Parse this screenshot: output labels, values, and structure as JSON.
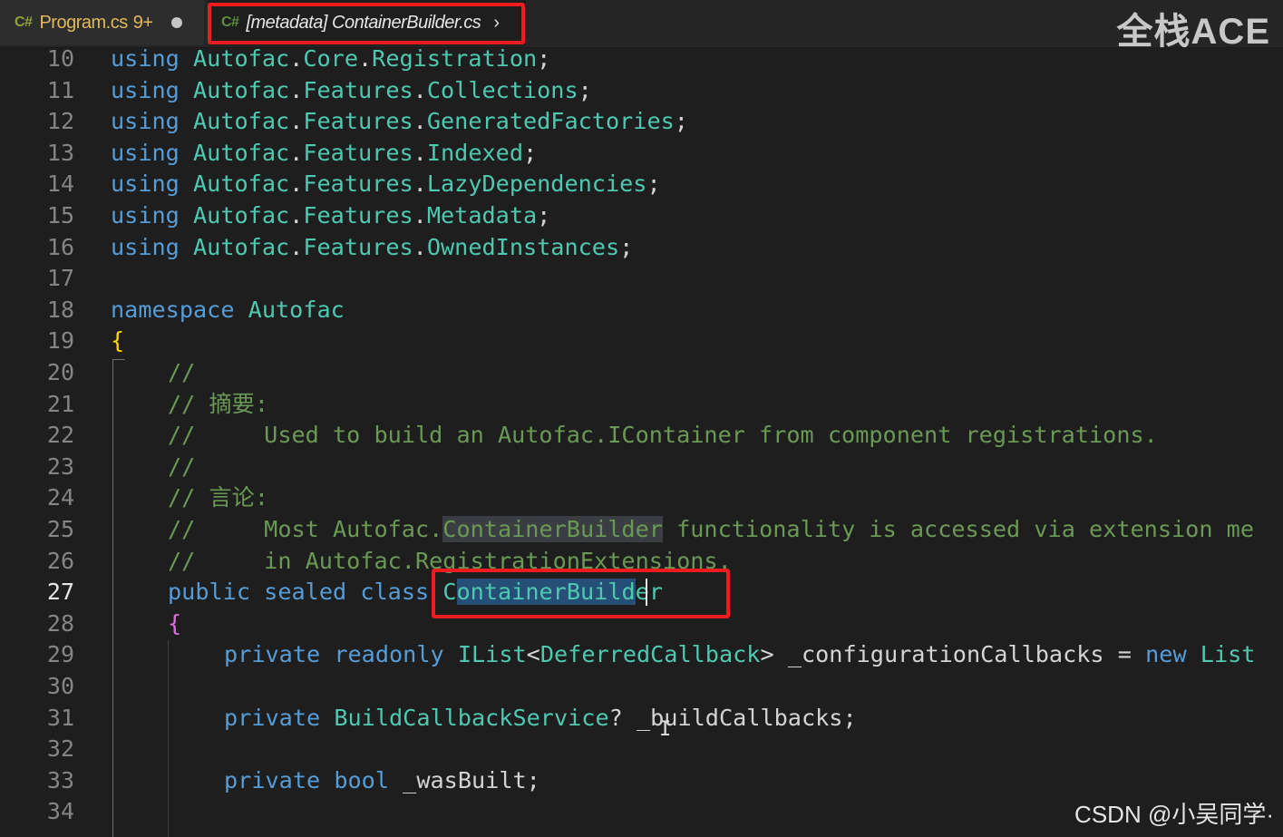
{
  "tabs": [
    {
      "lang": "C#",
      "name": "Program.cs",
      "problems": "9+"
    },
    {
      "lang": "C#",
      "name": "[metadata] ContainerBuilder.cs"
    }
  ],
  "watermark": "全栈ACE",
  "footer_credit": "CSDN @小吴同学·",
  "active_line": "27",
  "lines": {
    "l10": {
      "no": "10",
      "t": [
        "using",
        "Autofac",
        ".",
        "Core",
        ".",
        "Registration",
        ";"
      ]
    },
    "l11": {
      "no": "11",
      "t": [
        "using",
        "Autofac",
        ".",
        "Features",
        ".",
        "Collections",
        ";"
      ]
    },
    "l12": {
      "no": "12",
      "t": [
        "using",
        "Autofac",
        ".",
        "Features",
        ".",
        "GeneratedFactories",
        ";"
      ]
    },
    "l13": {
      "no": "13",
      "t": [
        "using",
        "Autofac",
        ".",
        "Features",
        ".",
        "Indexed",
        ";"
      ]
    },
    "l14": {
      "no": "14",
      "t": [
        "using",
        "Autofac",
        ".",
        "Features",
        ".",
        "LazyDependencies",
        ";"
      ]
    },
    "l15": {
      "no": "15",
      "t": [
        "using",
        "Autofac",
        ".",
        "Features",
        ".",
        "Metadata",
        ";"
      ]
    },
    "l16": {
      "no": "16",
      "t": [
        "using",
        "Autofac",
        ".",
        "Features",
        ".",
        "OwnedInstances",
        ";"
      ]
    },
    "l17": {
      "no": "17"
    },
    "l18": {
      "no": "18",
      "t": [
        "namespace",
        "Autofac"
      ]
    },
    "l19": {
      "no": "19",
      "t": [
        "{"
      ]
    },
    "l20": {
      "no": "20",
      "t": [
        "//"
      ]
    },
    "l21": {
      "no": "21",
      "t": [
        "// 摘要:"
      ]
    },
    "l22": {
      "no": "22",
      "t": [
        "//     Used to build an Autofac.IContainer from component registrations."
      ]
    },
    "l23": {
      "no": "23",
      "t": [
        "//"
      ]
    },
    "l24": {
      "no": "24",
      "t": [
        "// 言论:"
      ]
    },
    "l25": {
      "no": "25",
      "t": [
        "//     Most Autofac.",
        "ContainerBuilder",
        " functionality is accessed via extension me"
      ]
    },
    "l26": {
      "no": "26",
      "t": [
        "//     in Autofac.RegistrationExtensions."
      ]
    },
    "l27": {
      "no": "27",
      "t": [
        "public",
        "sealed",
        "class",
        "C",
        "ontainerBuild",
        "er"
      ]
    },
    "l28": {
      "no": "28",
      "t": [
        "{"
      ]
    },
    "l29": {
      "no": "29",
      "t": [
        "private",
        "readonly",
        "IList",
        "<",
        "DeferredCallback",
        ">",
        "_configurationCallbacks",
        "=",
        "new",
        "List"
      ]
    },
    "l30": {
      "no": "30"
    },
    "l31": {
      "no": "31",
      "t": [
        "private",
        "BuildCallbackService",
        "?",
        "_buildCallbacks",
        ";"
      ]
    },
    "l32": {
      "no": "32"
    },
    "l33": {
      "no": "33",
      "t": [
        "private",
        "bool",
        "_wasBuilt",
        ";"
      ]
    },
    "l34": {
      "no": "34"
    }
  }
}
